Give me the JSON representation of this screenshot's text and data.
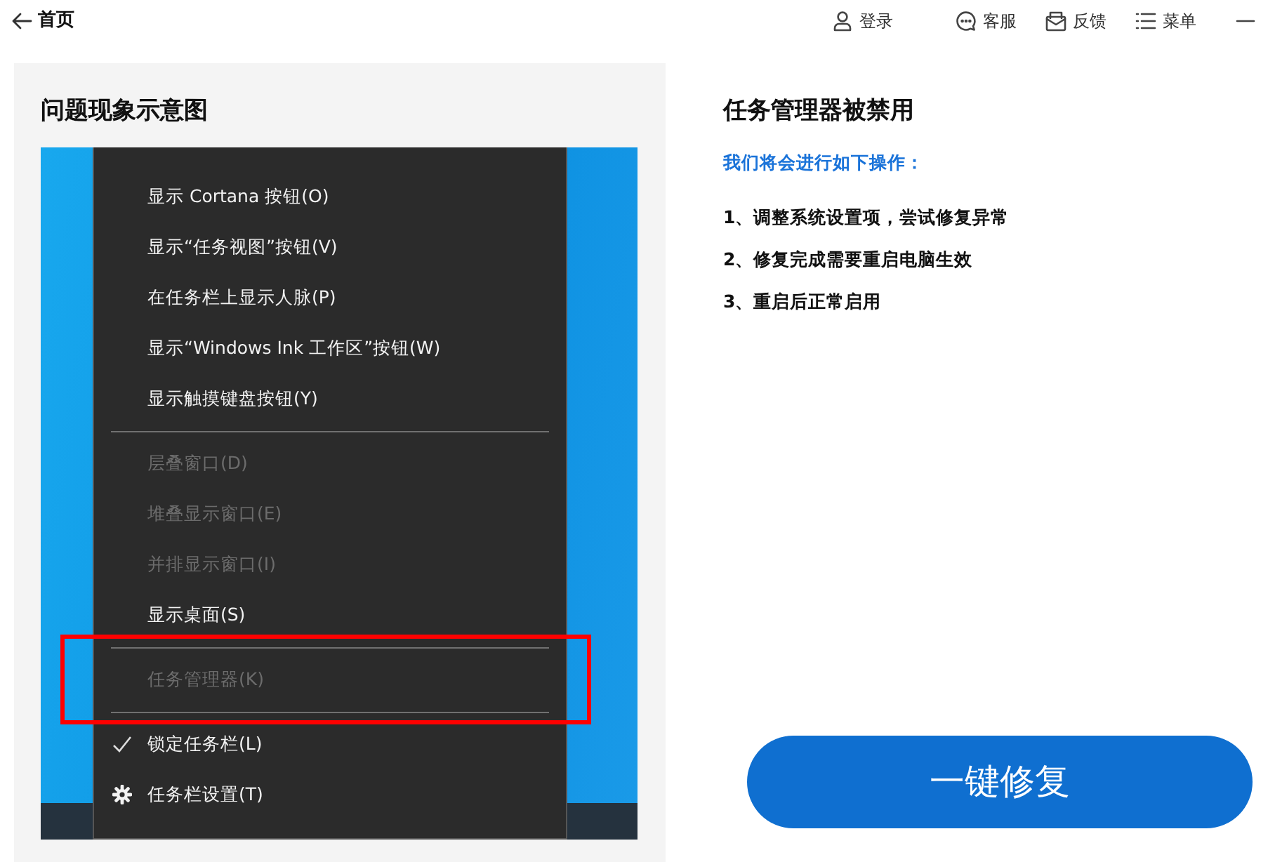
{
  "header": {
    "back_label": "首页",
    "actions": [
      {
        "kind": "user",
        "label": "登录"
      },
      {
        "kind": "chat",
        "label": "客服"
      },
      {
        "kind": "feedback",
        "label": "反馈"
      },
      {
        "kind": "menu",
        "label": "菜单"
      },
      {
        "kind": "minimize"
      }
    ]
  },
  "left_panel": {
    "title": "问题现象示意图",
    "context_menu": {
      "items": [
        {
          "kind": "item",
          "label": "显示 Cortana 按钮(O)",
          "disabled": false
        },
        {
          "kind": "item",
          "label": "显示“任务视图”按钮(V)",
          "disabled": false
        },
        {
          "kind": "item",
          "label": "在任务栏上显示人脉(P)",
          "disabled": false
        },
        {
          "kind": "item",
          "label": "显示“Windows Ink 工作区”按钮(W)",
          "disabled": false
        },
        {
          "kind": "item",
          "label": "显示触摸键盘按钮(Y)",
          "disabled": false
        },
        {
          "kind": "separator"
        },
        {
          "kind": "item",
          "label": "层叠窗口(D)",
          "disabled": true
        },
        {
          "kind": "item",
          "label": "堆叠显示窗口(E)",
          "disabled": true
        },
        {
          "kind": "item",
          "label": "并排显示窗口(I)",
          "disabled": true
        },
        {
          "kind": "item",
          "label": "显示桌面(S)",
          "disabled": false
        },
        {
          "kind": "separator"
        },
        {
          "kind": "item",
          "label": "任务管理器(K)",
          "disabled": true,
          "highlighted": true
        },
        {
          "kind": "separator"
        },
        {
          "kind": "item",
          "label": "锁定任务栏(L)",
          "disabled": false,
          "checked": true
        },
        {
          "kind": "gear_item",
          "label": "任务栏设置(T)",
          "disabled": false
        }
      ]
    }
  },
  "right_panel": {
    "title": "任务管理器被禁用",
    "subtitle": "我们将会进行如下操作：",
    "steps": [
      "1、调整系统设置项，尝试修复异常",
      "2、修复完成需要重启电脑生效",
      "3、重启后正常启用"
    ],
    "fix_button": "一键修复"
  }
}
